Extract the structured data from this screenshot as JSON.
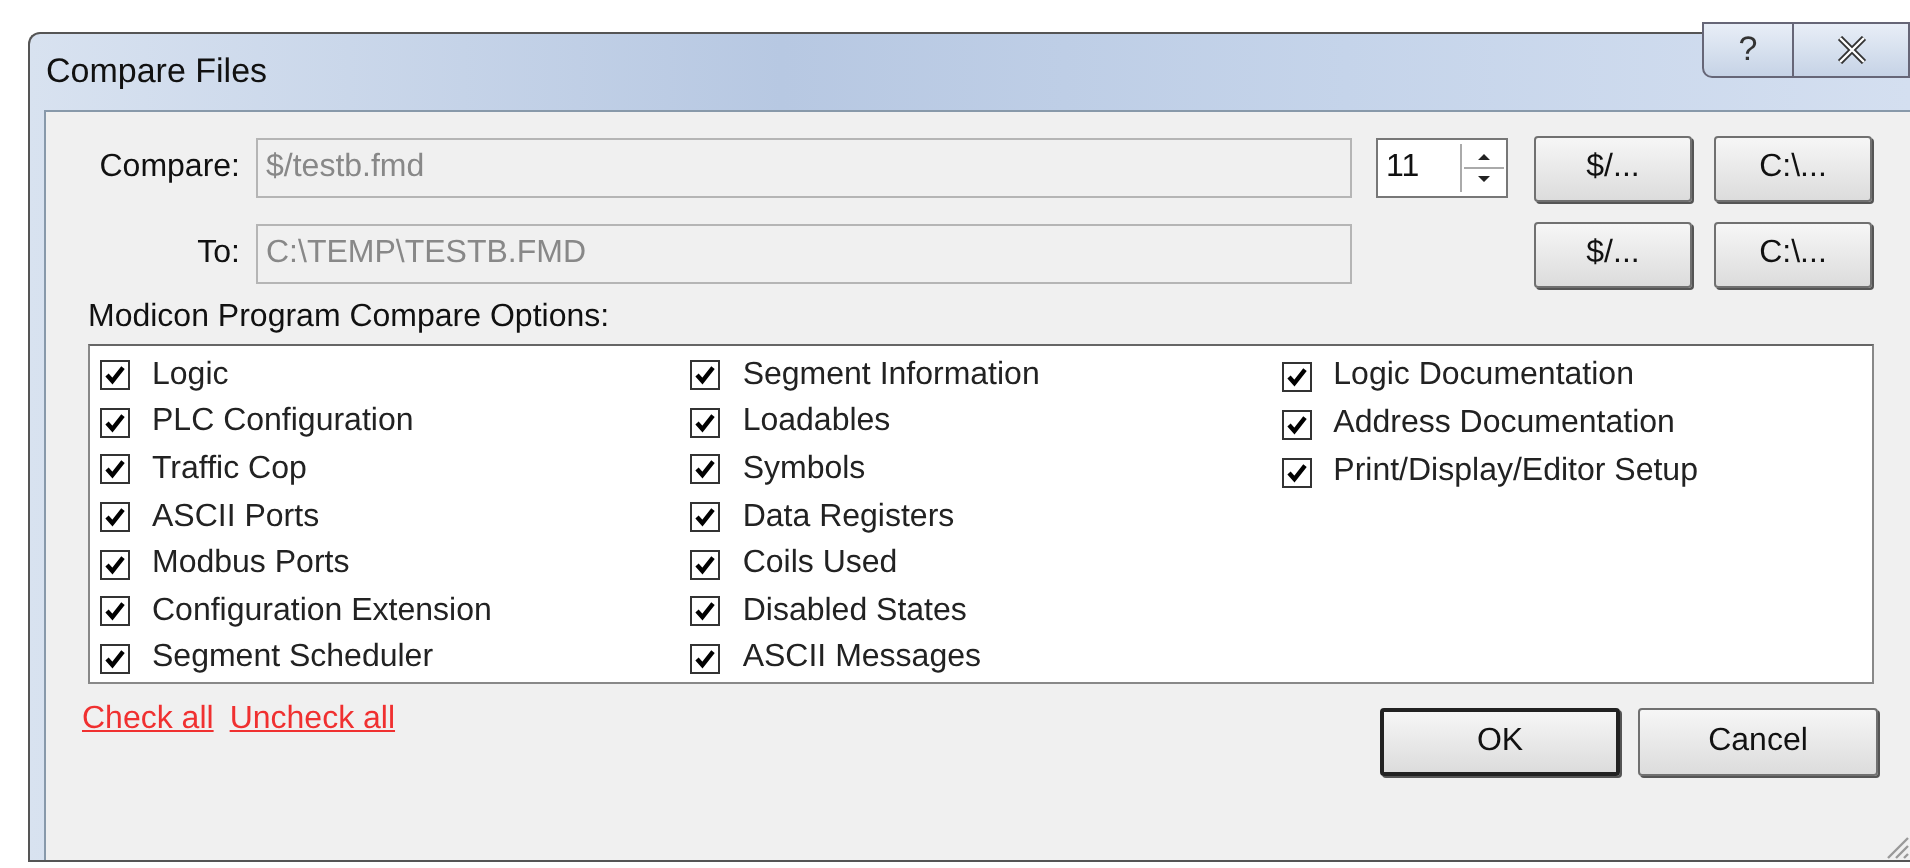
{
  "window": {
    "title": "Compare Files",
    "help_button": "?"
  },
  "compare": {
    "label": "Compare:",
    "value": "$/testb.fmd",
    "spinner_value": "11",
    "buttons": [
      "$/...",
      "C:\\..."
    ]
  },
  "to": {
    "label": "To:",
    "value": "C:\\TEMP\\TESTB.FMD",
    "buttons": [
      "$/...",
      "C:\\..."
    ]
  },
  "options": {
    "label": "Modicon Program Compare Options:",
    "columns": [
      [
        {
          "label": "Logic",
          "checked": true
        },
        {
          "label": "PLC Configuration",
          "checked": true
        },
        {
          "label": "Traffic Cop",
          "checked": true
        },
        {
          "label": "ASCII Ports",
          "checked": true
        },
        {
          "label": "Modbus Ports",
          "checked": true
        },
        {
          "label": "Configuration Extension",
          "checked": true
        },
        {
          "label": "Segment Scheduler",
          "checked": true
        }
      ],
      [
        {
          "label": "Segment Information",
          "checked": true
        },
        {
          "label": "Loadables",
          "checked": true
        },
        {
          "label": "Symbols",
          "checked": true
        },
        {
          "label": "Data Registers",
          "checked": true
        },
        {
          "label": "Coils Used",
          "checked": true
        },
        {
          "label": "Disabled States",
          "checked": true
        },
        {
          "label": "ASCII Messages",
          "checked": true
        }
      ],
      [
        {
          "label": "Logic Documentation",
          "checked": true
        },
        {
          "label": "Address Documentation",
          "checked": true
        },
        {
          "label": "Print/Display/Editor Setup",
          "checked": true
        }
      ]
    ]
  },
  "links": [
    "Check all",
    "Uncheck all"
  ],
  "buttons": [
    "OK",
    "Cancel"
  ]
}
